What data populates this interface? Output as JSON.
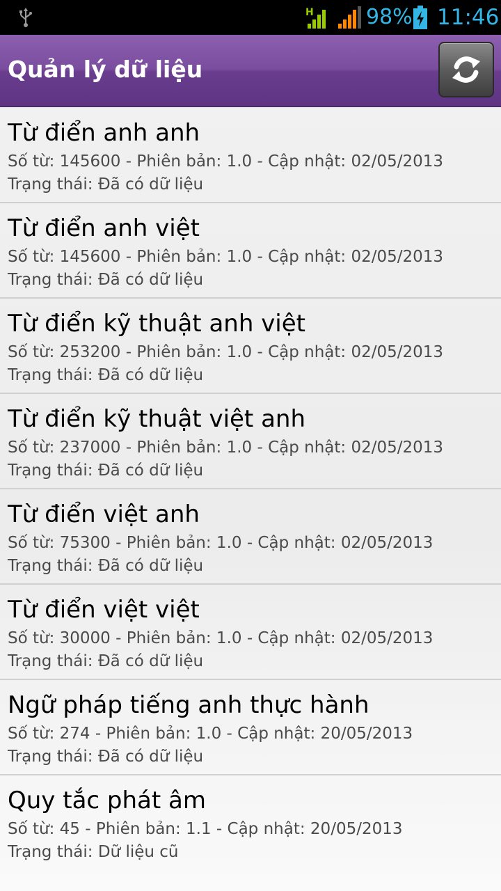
{
  "status_bar": {
    "battery_percent": "98%",
    "time": "11:46",
    "network_type": "H",
    "icons": [
      "usb-icon",
      "network-h-icon",
      "signal-icon",
      "battery-charging-icon"
    ],
    "accent_color": "#33b5e5"
  },
  "action_bar": {
    "title": "Quản lý dữ liệu",
    "refresh_icon": "refresh-icon",
    "color": "#7b4d9f"
  },
  "list": {
    "items": [
      {
        "title": "Từ điển anh anh",
        "info": "Số từ: 145600 - Phiên bản: 1.0 - Cập nhật: 02/05/2013",
        "status": "Trạng thái: Đã có dữ liệu"
      },
      {
        "title": "Từ điển anh việt",
        "info": "Số từ: 145600 - Phiên bản: 1.0 - Cập nhật: 02/05/2013",
        "status": "Trạng thái: Đã có dữ liệu"
      },
      {
        "title": "Từ điển kỹ thuật anh việt",
        "info": "Số từ: 253200 - Phiên bản: 1.0 - Cập nhật: 02/05/2013",
        "status": "Trạng thái: Đã có dữ liệu"
      },
      {
        "title": "Từ điển kỹ thuật việt anh",
        "info": "Số từ: 237000 - Phiên bản: 1.0 - Cập nhật: 02/05/2013",
        "status": "Trạng thái: Đã có dữ liệu"
      },
      {
        "title": "Từ điển việt anh",
        "info": "Số từ: 75300 - Phiên bản: 1.0 - Cập nhật: 02/05/2013",
        "status": "Trạng thái: Đã có dữ liệu"
      },
      {
        "title": "Từ điển việt việt",
        "info": "Số từ: 30000 - Phiên bản: 1.0 - Cập nhật: 02/05/2013",
        "status": "Trạng thái: Đã có dữ liệu"
      },
      {
        "title": "Ngữ pháp tiếng anh thực hành",
        "info": "Số từ: 274 - Phiên bản: 1.0 - Cập nhật: 20/05/2013",
        "status": "Trạng thái: Đã có dữ liệu"
      },
      {
        "title": "Quy tắc phát âm",
        "info": "Số từ: 45 - Phiên bản: 1.1 - Cập nhật: 20/05/2013",
        "status": "Trạng thái: Dữ liệu cũ"
      }
    ]
  }
}
